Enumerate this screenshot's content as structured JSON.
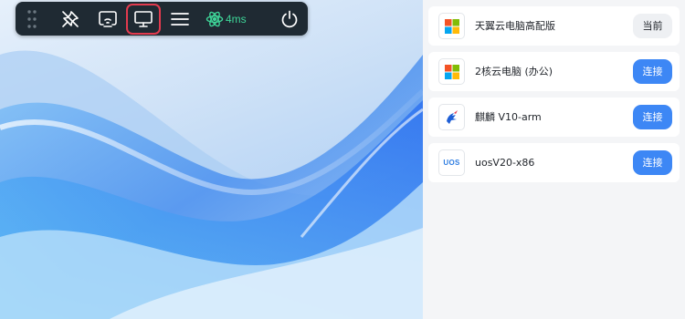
{
  "toolbar": {
    "icons": [
      "drag-grip-icon",
      "pin-icon",
      "cast-screen-icon",
      "monitor-icon",
      "menu-icon",
      "latency-icon",
      "power-icon"
    ],
    "latency": "4ms",
    "colors": {
      "background": "#1f2a33",
      "latency": "#3ed598",
      "selected_outline": "#e23a4e"
    }
  },
  "machines": [
    {
      "name": "天翼云电脑高配版",
      "icon": "windows-logo-icon",
      "action": "当前",
      "state": "current"
    },
    {
      "name": "2核云电脑 (办公)",
      "icon": "windows-logo-icon",
      "action": "连接",
      "state": "available"
    },
    {
      "name": "麒麟 V10-arm",
      "icon": "kylin-logo-icon",
      "action": "连接",
      "state": "available"
    },
    {
      "name": "uosV20-x86",
      "icon": "uos-logo-icon",
      "logo_text": "UOS",
      "action": "连接",
      "state": "available"
    }
  ],
  "colors": {
    "connect_button": "#3d87f5",
    "current_button": "#eef0f3",
    "panel_bg": "#f4f5f7"
  }
}
